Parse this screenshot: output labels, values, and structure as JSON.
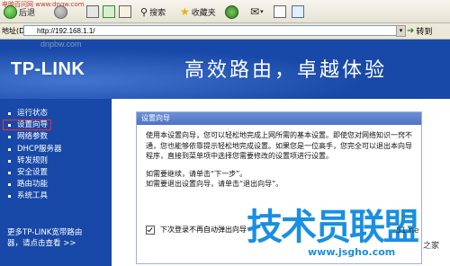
{
  "browser": {
    "watermark_site": "电脑百问网 www.dnqw.com",
    "back_label": "后退",
    "search_label": "搜索",
    "favorites_label": "收藏夹",
    "address_label": "地址(D)",
    "url": "http://192.168.1.1/",
    "go_label": "转到",
    "faded_watermark": "dnpbw.com"
  },
  "header": {
    "logo": "TP-LINK",
    "slogan": "高效路由，卓越体验"
  },
  "sidebar": {
    "items": [
      {
        "label": "运行状态"
      },
      {
        "label": "设置向导"
      },
      {
        "label": "网络参数"
      },
      {
        "label": "DHCP服务器"
      },
      {
        "label": "转发规则"
      },
      {
        "label": "安全设置"
      },
      {
        "label": "路由功能"
      },
      {
        "label": "系统工具"
      }
    ],
    "selected_index": 1,
    "more_line1": "更多TP-LINK宽带路由",
    "more_line2": "器，请点击查看 >>"
  },
  "wizard": {
    "title": "设置向导",
    "para1": "使用本设置向导，您可以轻松地完成上网所需的基本设置。即使您对网络知识一窍不通，您也能够依靠提示轻松地完成设置。如果您是一位高手，您完全可以退出本向导程序，直接到菜单项中选择您需要修改的设置项进行设置。",
    "para2_line1": "如需要继续，请单击“下一步”。",
    "para2_line2": "如需要退出设置向导，请单击“退出向导”。",
    "checkbox_label": "下次登录不再自动弹出向导",
    "checkbox_checked": true
  },
  "overlay": {
    "brand": "技术员联盟",
    "url": "www.jsgho.com",
    "corner_1": "51.ne",
    "corner_2": "之家"
  }
}
